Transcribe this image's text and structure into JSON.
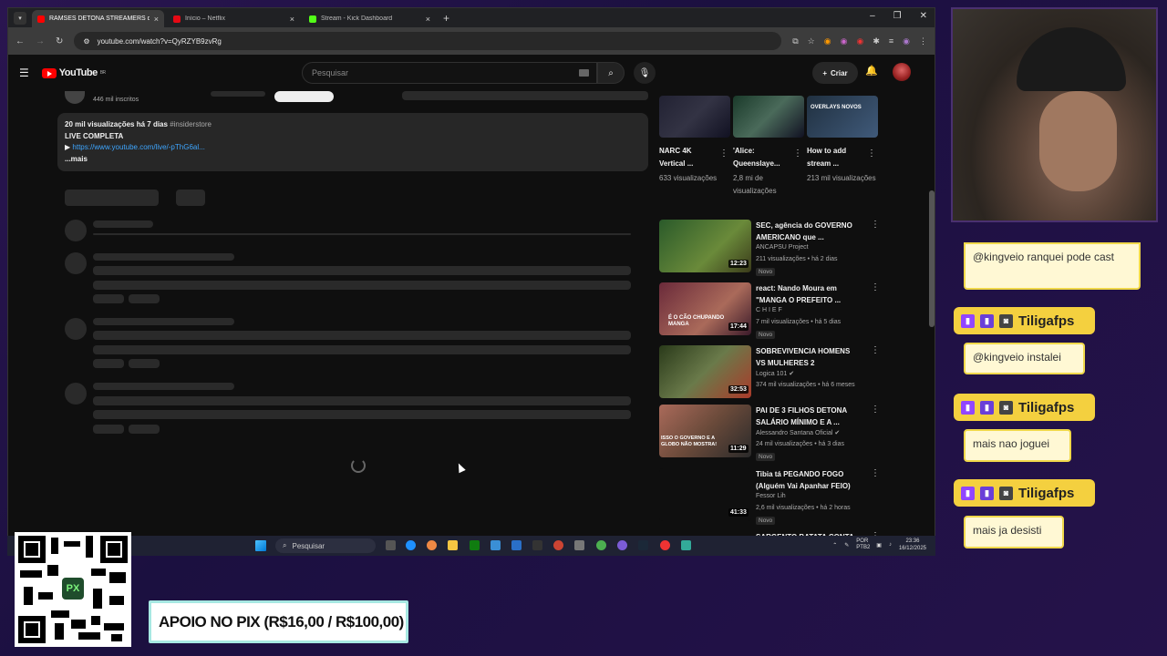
{
  "browser": {
    "tabs": [
      {
        "label": "RAMSÉS DETONA STREAMERS qu",
        "favicon_color": "#ff0000",
        "active": true
      },
      {
        "label": "Início – Netflix",
        "favicon_color": "#e50914",
        "active": false
      },
      {
        "label": "Stream - Kick Dashboard",
        "favicon_color": "#53fc18",
        "active": false
      }
    ],
    "url": "youtube.com/watch?v=QyRZYB9zvRg"
  },
  "youtube": {
    "logo_text": "YouTube",
    "logo_region": "BR",
    "search_placeholder": "Pesquisar",
    "create_label": "Criar",
    "channel_subscribers": "446 mil inscritos",
    "description": {
      "meta": "20 mil visualizações  há 7 dias",
      "hashtag": "#insiderstore",
      "line1": "LIVE COMPLETA",
      "link_prefix": "▶",
      "link": "https://www.youtube.com/live/-pThG6al...",
      "more": "...mais"
    }
  },
  "sidebar": {
    "shorts": [
      {
        "title": "NARC 4K Vertical ...",
        "views": "633 visualizações"
      },
      {
        "title": "'Alice: Queenslaye...",
        "views": "2,8 mi de visualizações"
      },
      {
        "title": "How to add stream ...",
        "views": "213 mil visualizações",
        "thumb_text": "OVERLAYS NOVOS"
      }
    ],
    "videos": [
      {
        "title": "SEC, agência do GOVERNO AMERICANO que ...",
        "channel": "ANCAPSU Project",
        "stats": "211 visualizações • há 2 dias",
        "badge": "Novo",
        "duration": "12:23",
        "thumb": "#3a7a3a"
      },
      {
        "title": "react: Nando Moura em \"MANGA O PREFEITO ...",
        "channel": "C H I E F",
        "stats": "7 mil visualizações • há 5 dias",
        "badge": "Novo",
        "duration": "17:44",
        "thumb": "#7a3a4a",
        "thumb_text": "É O CÃO CHUPANDO MANGA"
      },
      {
        "title": "SOBREVIVENCIA HOMENS VS MULHERES 2",
        "channel": "Logica 101",
        "stats": "374 mil visualizações • há 6 meses",
        "badge": "",
        "duration": "32:53",
        "thumb": "#5a6a3a"
      },
      {
        "title": "PAI DE 3 FILHOS DETONA SALÁRIO MÍNIMO E A ...",
        "channel": "Alessandro Santana Oficial",
        "stats": "24 mil visualizações • há 3 dias",
        "badge": "Novo",
        "duration": "11:29",
        "thumb": "#8a4a3a",
        "thumb_text": "ISSO O GOVERNO E A GLOBO NÃO MOSTRA!"
      },
      {
        "title": "Tibia tá PEGANDO FOGO (Alguém Vai Apanhar FEIO)",
        "channel": "Fessor Lih",
        "stats": "2,6 mil visualizações • há 2 horas",
        "badge": "Novo",
        "duration": "41:33",
        "thumb": "#000000"
      },
      {
        "title": "SARGENTO BATATA CONTA",
        "channel": "",
        "stats": "",
        "badge": "",
        "duration": "",
        "thumb": "#000000"
      }
    ]
  },
  "taskbar": {
    "search_label": "Pesquisar",
    "lang": "POR PTB2",
    "time": "23:36",
    "date": "16/12/2025"
  },
  "chat": {
    "first_message": "@kingveio ranquei pode cast",
    "entries": [
      {
        "user": "Tiligafps",
        "message": "@kingveio instalei"
      },
      {
        "user": "Tiligafps",
        "message": "mais nao joguei"
      },
      {
        "user": "Tiligafps",
        "message": "mais ja desisti"
      }
    ]
  },
  "overlay": {
    "pix_text": "APOIO NO PIX (R$16,00 / R$100,00)",
    "qr_logo": "PX"
  }
}
